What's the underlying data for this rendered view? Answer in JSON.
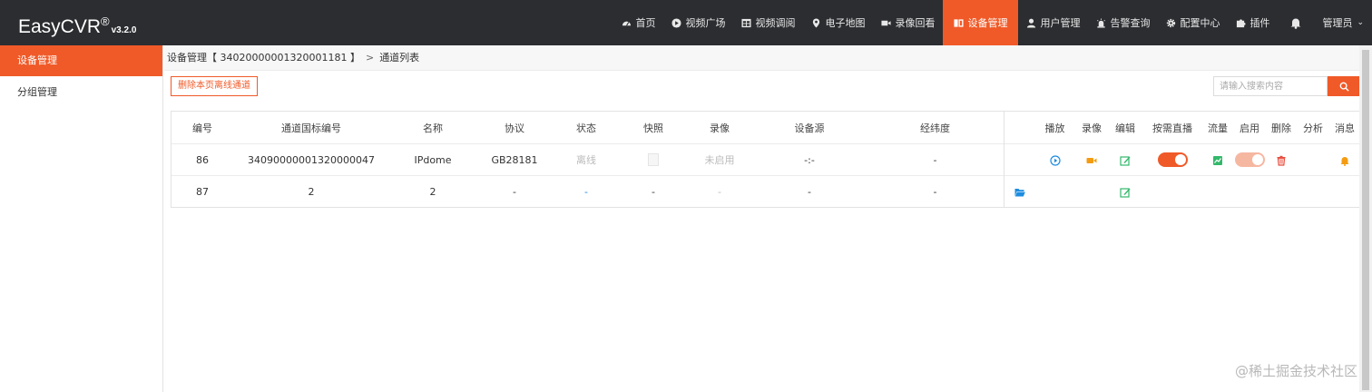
{
  "brand": {
    "name": "EasyCVR",
    "reg": "®",
    "version": "v3.2.0"
  },
  "nav": [
    {
      "label": "首页",
      "icon": "dashboard-icon"
    },
    {
      "label": "视频广场",
      "icon": "play-circle-icon"
    },
    {
      "label": "视频调阅",
      "icon": "grid-icon"
    },
    {
      "label": "电子地图",
      "icon": "map-marker-icon"
    },
    {
      "label": "录像回看",
      "icon": "video-camera-icon"
    },
    {
      "label": "设备管理",
      "icon": "device-icon",
      "active": true
    },
    {
      "label": "用户管理",
      "icon": "user-icon"
    },
    {
      "label": "告警查询",
      "icon": "alarm-icon"
    },
    {
      "label": "配置中心",
      "icon": "gear-icon"
    },
    {
      "label": "插件",
      "icon": "puzzle-icon"
    }
  ],
  "user": {
    "label": "管理员",
    "caret": "⌄"
  },
  "sidebar": {
    "items": [
      {
        "label": "设备管理",
        "active": true
      },
      {
        "label": "分组管理"
      }
    ]
  },
  "breadcrumb": {
    "parent": "设备管理【 34020000001320001181 】",
    "separator": ">",
    "current": "通道列表"
  },
  "toolbar": {
    "delete_offline_label": "删除本页离线通道"
  },
  "search": {
    "placeholder": "请输入搜索内容",
    "icon": "search-icon"
  },
  "table": {
    "left_headers": [
      "编号",
      "通道国标编号",
      "名称",
      "协议",
      "状态",
      "快照",
      "录像",
      "设备源",
      "经纬度"
    ],
    "right_headers": [
      "播放",
      "录像",
      "编辑",
      "按需直播",
      "流量",
      "启用",
      "删除",
      "分析",
      "消息"
    ],
    "rows": [
      {
        "id": "86",
        "gb_id": "34090000001320000047",
        "name": "IPdome",
        "protocol": "GB28181",
        "status": "离线",
        "snapshot": "",
        "record": "未启用",
        "source": "-:-",
        "location": "-"
      },
      {
        "id": "87",
        "gb_id": "2",
        "name": "2",
        "protocol": "-",
        "status": "-",
        "snapshot": "-",
        "record": "-",
        "source": "-",
        "location": "-"
      }
    ]
  },
  "colors": {
    "accent": "#f05a28",
    "topbar": "#2b2d30",
    "link_blue": "#1d8ce0",
    "green": "#33b86b",
    "orange": "#f39c12"
  },
  "watermark": "@稀土掘金技术社区"
}
